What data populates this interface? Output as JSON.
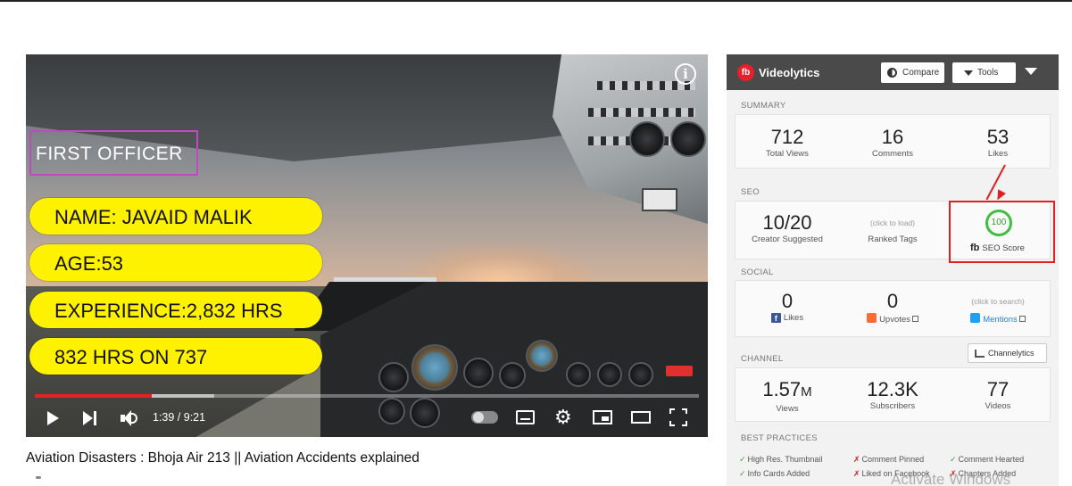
{
  "player": {
    "overlay_title": "FIRST OFFICER",
    "info_pills": [
      "NAME: JAVAID MALIK",
      "AGE:53",
      "EXPERIENCE:2,832 HRS",
      "832 HRS ON 737"
    ],
    "time_display": "1:39 / 9:21",
    "progress_fraction": 0.176,
    "buffer_fraction": 0.27,
    "colors": {
      "progress": "#e52020",
      "pill": "#fff200",
      "officer_border": "#c048c0"
    }
  },
  "video": {
    "title": "Aviation Disasters : Bhoja Air 213 || Aviation Accidents explained"
  },
  "panel": {
    "brand": "Videolytics",
    "compare_label": "Compare",
    "tools_label": "Tools",
    "summary": {
      "label": "SUMMARY",
      "stats": [
        {
          "value": "712",
          "label": "Total Views"
        },
        {
          "value": "16",
          "label": "Comments"
        },
        {
          "value": "53",
          "label": "Likes"
        }
      ]
    },
    "seo": {
      "label": "SEO",
      "creator_value": "10/20",
      "creator_label": "Creator Suggested",
      "tags_hint": "(click to load)",
      "tags_label": "Ranked Tags",
      "score": "100",
      "score_label": "SEO Score",
      "score_mark": "fb"
    },
    "social": {
      "label": "SOCIAL",
      "likes_value": "0",
      "likes_label": "Likes",
      "upvotes_value": "0",
      "upvotes_label": "Upvotes",
      "search_hint": "(click to search)",
      "mentions_label": "Mentions"
    },
    "channel": {
      "label": "CHANNEL",
      "button": "Channelytics",
      "views_value": "1.57",
      "views_unit": "M",
      "views_label": "Views",
      "subs_value": "12.3K",
      "subs_label": "Subscribers",
      "videos_value": "77",
      "videos_label": "Videos"
    },
    "best_practices": {
      "label": "BEST PRACTICES",
      "items": [
        {
          "status": "ok",
          "text": "High Res. Thumbnail"
        },
        {
          "status": "bad",
          "text": "Comment Pinned"
        },
        {
          "status": "ok",
          "text": "Comment Hearted"
        },
        {
          "status": "ok",
          "text": "Info Cards Added"
        },
        {
          "status": "bad",
          "text": "Liked on Facebook"
        },
        {
          "status": "bad",
          "text": "Chapters Added"
        }
      ]
    }
  },
  "watermark": "Activate Windows"
}
